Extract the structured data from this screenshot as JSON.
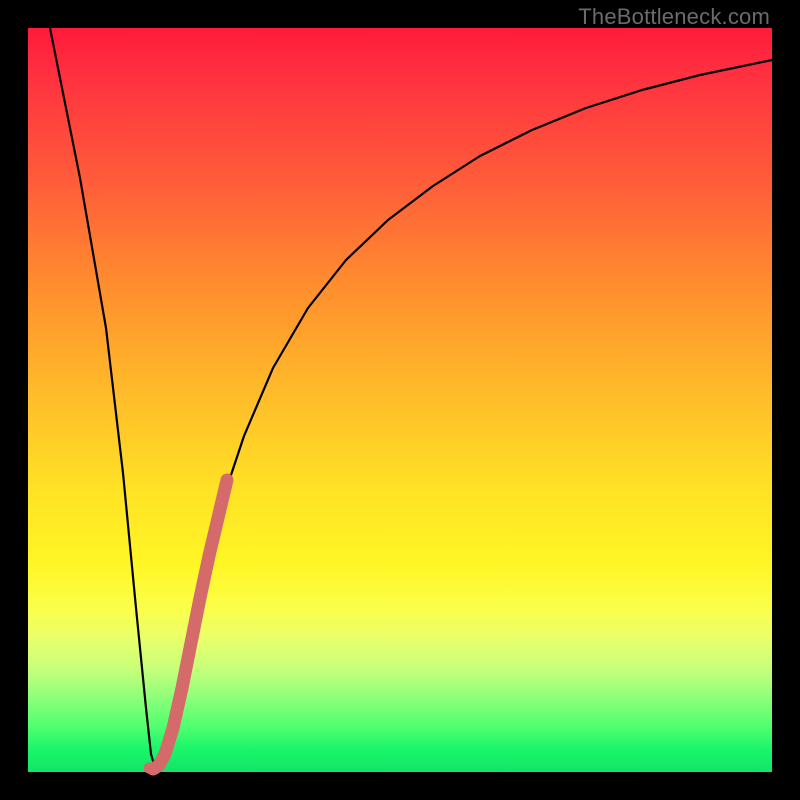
{
  "watermark": "TheBottleneck.com",
  "colors": {
    "curve": "#000000",
    "highlight": "#d46a6a",
    "frame": "#000000"
  },
  "chart_data": {
    "type": "line",
    "title": "",
    "xlabel": "",
    "ylabel": "",
    "xlim": [
      0,
      100
    ],
    "ylim": [
      0,
      100
    ],
    "series": [
      {
        "name": "bottleneck-curve",
        "x": [
          3,
          5,
          7,
          9,
          11,
          13,
          14.5,
          16,
          18,
          20,
          22,
          24,
          27,
          30,
          34,
          38,
          43,
          48,
          54,
          60,
          67,
          74,
          82,
          90,
          100
        ],
        "y": [
          100,
          80,
          60,
          40,
          22,
          8,
          2,
          0.5,
          6,
          16,
          26,
          35,
          45,
          53,
          61,
          68,
          74,
          79,
          83,
          86.5,
          89.5,
          91.8,
          93.5,
          94.8,
          96
        ]
      },
      {
        "name": "highlight-segment",
        "x": [
          15.0,
          15.5,
          16.2,
          17.0,
          18.0,
          19.2,
          20.5,
          21.8,
          23.0,
          24.2,
          25.5
        ],
        "y": [
          0.3,
          0.2,
          1.0,
          3.0,
          8.0,
          14.0,
          20.0,
          26.0,
          31.5,
          36.5,
          41.0
        ]
      }
    ],
    "annotations": []
  }
}
